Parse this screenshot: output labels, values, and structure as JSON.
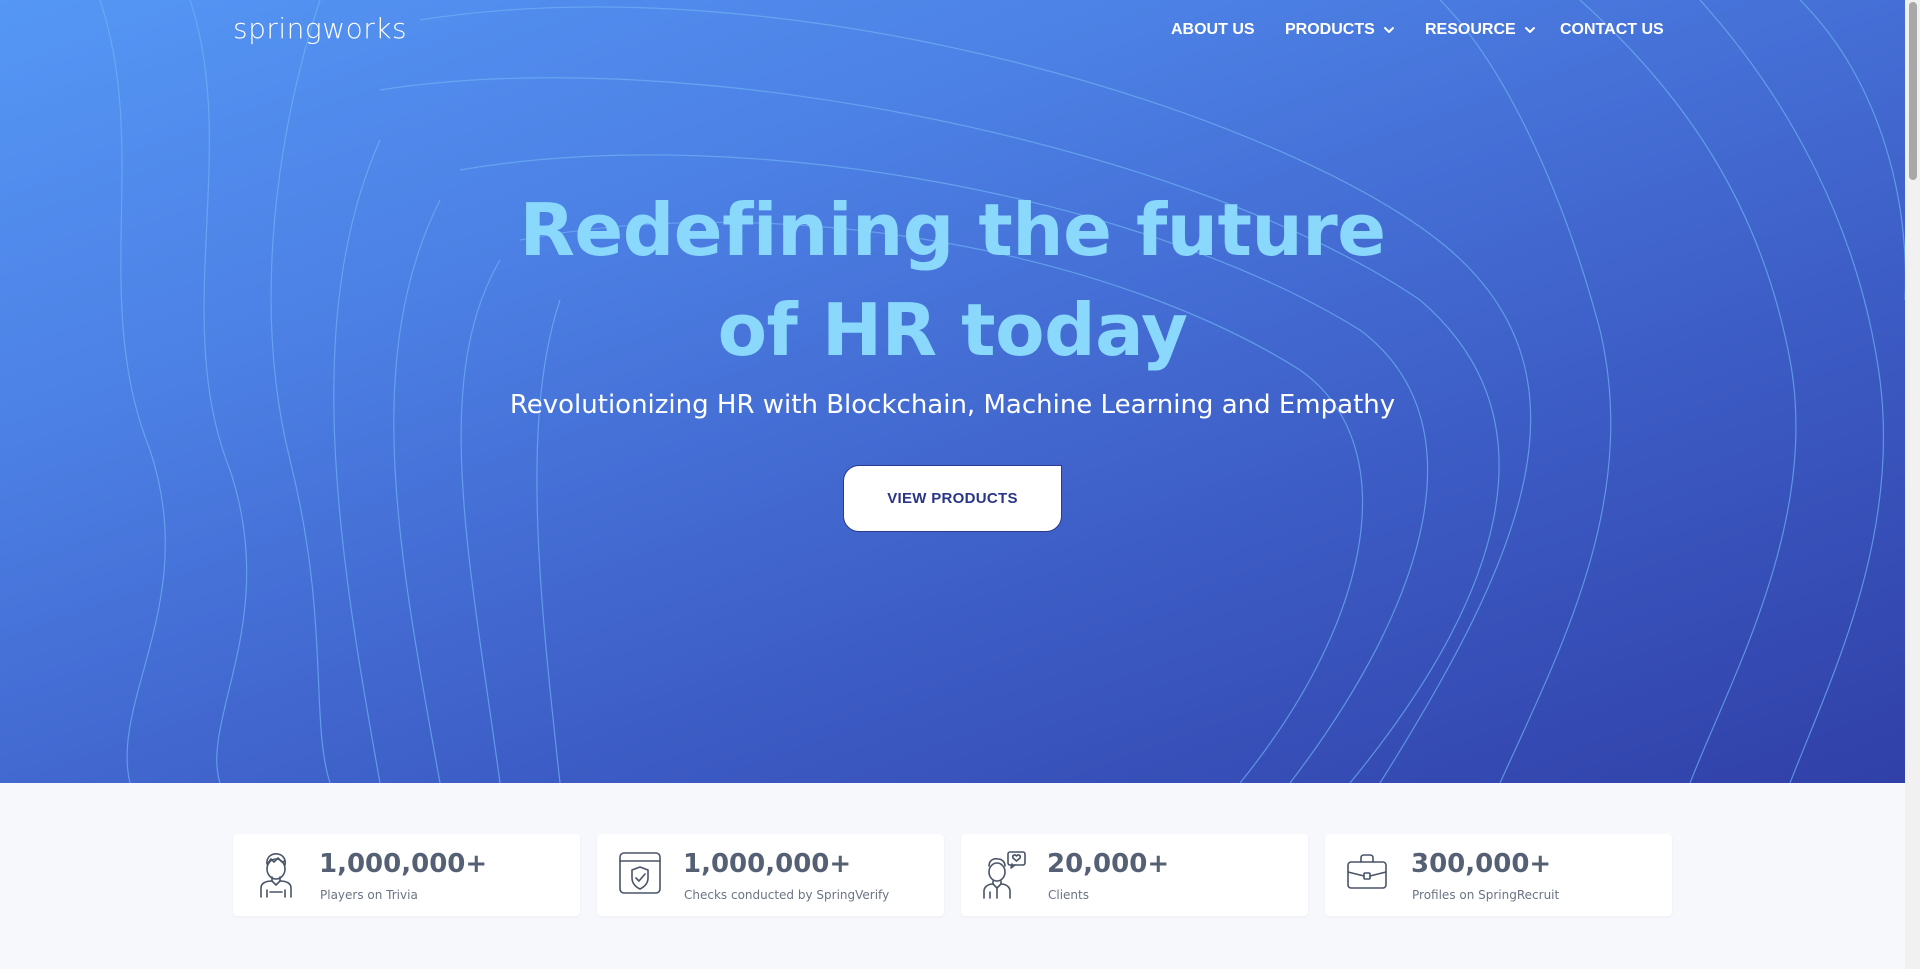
{
  "brand": {
    "logo_text": "springworks"
  },
  "nav": {
    "items": [
      {
        "label": "ABOUT US",
        "has_dropdown": false
      },
      {
        "label": "PRODUCTS",
        "has_dropdown": true
      },
      {
        "label": "RESOURCE",
        "has_dropdown": true
      },
      {
        "label": "CONTACT US",
        "has_dropdown": false
      }
    ]
  },
  "hero": {
    "headline_line1": "Redefining the future",
    "headline_line2": "of HR today",
    "subheadline": "Revolutionizing HR with Blockchain, Machine Learning and Empathy",
    "cta_label": "VIEW PRODUCTS"
  },
  "stats": [
    {
      "value": "1,000,000+",
      "label": "Players on Trivia",
      "icon": "person-icon"
    },
    {
      "value": "1,000,000+",
      "label": "Checks conducted by SpringVerify",
      "icon": "shield-check-icon"
    },
    {
      "value": "20,000+",
      "label": "Clients",
      "icon": "client-heart-icon"
    },
    {
      "value": "300,000+",
      "label": "Profiles on SpringRecruit",
      "icon": "briefcase-icon"
    }
  ],
  "colors": {
    "hero_gradient_start": "#5597f5",
    "hero_gradient_end": "#3040a8",
    "headline": "#8ad8fb",
    "cta_text": "#2a3589",
    "stat_text": "#566075",
    "page_bg": "#f7f8fc"
  }
}
